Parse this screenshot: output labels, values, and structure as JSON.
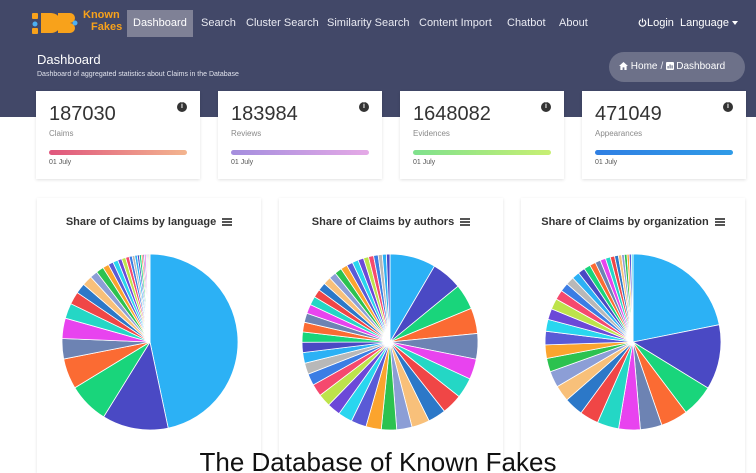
{
  "nav": {
    "logo_text_line1": "Known",
    "logo_text_line2": "Fakes",
    "items": [
      {
        "label": "Dashboard",
        "active": true
      },
      {
        "label": "Search"
      },
      {
        "label": "Cluster Search"
      },
      {
        "label": "Similarity Search"
      },
      {
        "label": "Content Import"
      },
      {
        "label": "Chatbot"
      },
      {
        "label": "About"
      }
    ],
    "login_icon": "power-icon",
    "login": "Login",
    "language": "Language"
  },
  "header": {
    "title": "Dashboard",
    "subtitle": "Dashboard of aggregated statistics about Claims in the Database",
    "breadcrumb_home": "Home",
    "breadcrumb_sep": "/",
    "breadcrumb_current": "Dashboard",
    "home_icon": "home-icon",
    "dashboard_icon": "dashboard-icon"
  },
  "stats": [
    {
      "value": "187030",
      "label": "Claims",
      "date": "01 July",
      "bar_colors": [
        "#e0567d",
        "#f3b58f"
      ]
    },
    {
      "value": "183984",
      "label": "Reviews",
      "date": "01 July",
      "bar_colors": [
        "#a48ede",
        "#e5a9e6"
      ]
    },
    {
      "value": "1648082",
      "label": "Evidences",
      "date": "01 July",
      "bar_colors": [
        "#7fe18d",
        "#c8ef73"
      ]
    },
    {
      "value": "471049",
      "label": "Appearances",
      "date": "01 July",
      "bar_colors": [
        "#2f7fe3",
        "#2f9be7"
      ]
    }
  ],
  "chart_data": [
    {
      "type": "pie",
      "title": "Share of Claims by language",
      "values": [
        50,
        13,
        8,
        6,
        4,
        4,
        3,
        2.5,
        2,
        2,
        1.5,
        1.5,
        1.2,
        1,
        1,
        0.8,
        0.8,
        0.7,
        0.6,
        0.5,
        0.5,
        0.4,
        0.4,
        0.3,
        0.3,
        0.3,
        0.2,
        0.2,
        0.2,
        0.2
      ]
    },
    {
      "type": "pie",
      "title": "Share of Claims by authors",
      "values": [
        9,
        6,
        5,
        5,
        5,
        4,
        4,
        4,
        3.5,
        3.5,
        3,
        3,
        3,
        3,
        2.8,
        2.6,
        2.5,
        2.4,
        2.3,
        2.2,
        2.1,
        2,
        2,
        1.9,
        1.8,
        1.8,
        1.7,
        1.6,
        1.6,
        1.5,
        1.4,
        1.4,
        1.3,
        1.2,
        1.2,
        1.1,
        1,
        1,
        0.9,
        0.8,
        0.8,
        0.7
      ]
    },
    {
      "type": "pie",
      "title": "Share of Claims by organization",
      "values": [
        22,
        12,
        6,
        5,
        4,
        4,
        4,
        3.5,
        3.5,
        3,
        3,
        2.5,
        2.5,
        2.5,
        2.2,
        2,
        2,
        1.8,
        1.6,
        1.5,
        1.4,
        1.3,
        1.2,
        1.1,
        1,
        1,
        0.9,
        0.8,
        0.7,
        0.6,
        0.5,
        0.5,
        0.4,
        0.4,
        0.3
      ]
    }
  ],
  "palette": [
    "#2cb1f5",
    "#4a49c4",
    "#19d57b",
    "#fb6b33",
    "#6d83b3",
    "#e843ef",
    "#24d7c5",
    "#f04646",
    "#2c78c8",
    "#f8c07a",
    "#8c9ed6",
    "#2cc24f",
    "#fba42e",
    "#5a5ad6",
    "#29d6ef",
    "#6c48d8",
    "#bde34b",
    "#f5496e",
    "#3b7de4",
    "#b8b8b8"
  ],
  "caption": "The Database of Known Fakes"
}
